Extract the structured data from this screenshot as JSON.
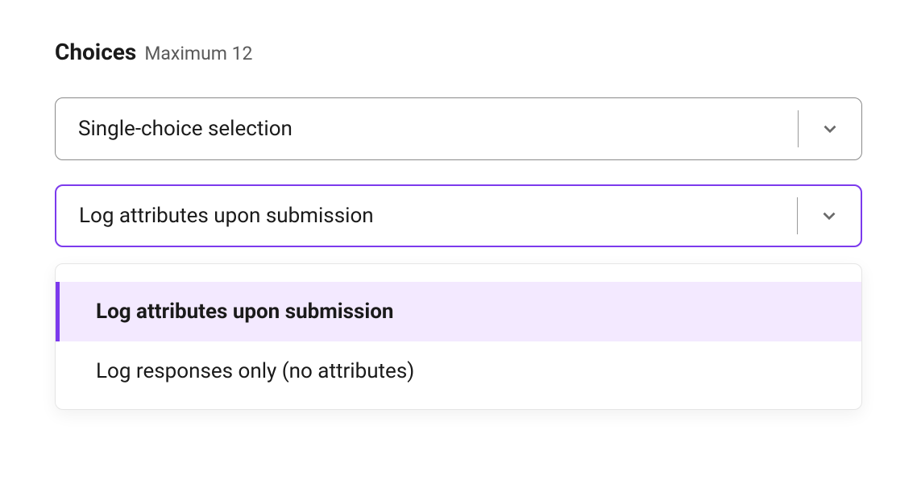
{
  "header": {
    "title": "Choices",
    "subtitle": "Maximum 12"
  },
  "select1": {
    "value": "Single-choice selection"
  },
  "select2": {
    "value": "Log attributes upon submission"
  },
  "dropdown": {
    "options": [
      "Log attributes upon submission",
      "Log responses only (no attributes)"
    ],
    "selectedIndex": 0
  },
  "colors": {
    "accent": "#7c3aed",
    "highlight": "#f3e9ff"
  }
}
